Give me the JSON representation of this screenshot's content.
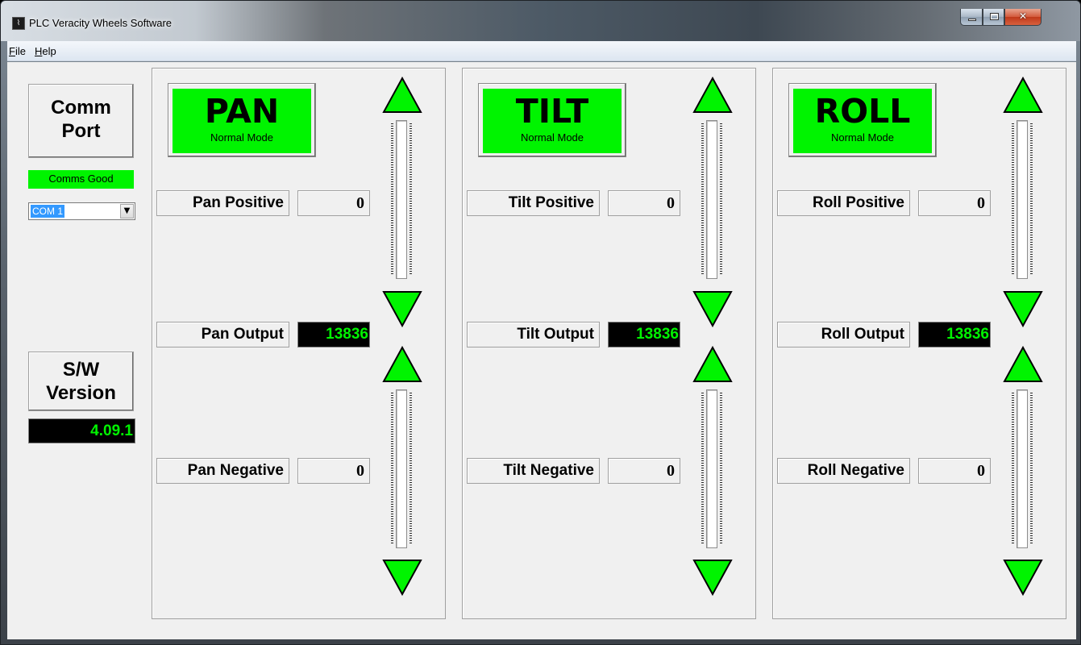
{
  "window": {
    "title": "PLC Veracity Wheels Software",
    "app_icon": "waveform-icon",
    "controls": {
      "minimize": "minimize-icon",
      "maximize": "maximize-icon",
      "close": "close-icon"
    }
  },
  "menu": [
    {
      "accel": "F",
      "rest": "ile"
    },
    {
      "accel": "H",
      "rest": "elp"
    }
  ],
  "left": {
    "comm_port_line1": "Comm",
    "comm_port_line2": "Port",
    "comms_status": "Comms Good",
    "com_select": {
      "value": "COM 1",
      "arrow": "▼"
    },
    "sw_line1": "S/W",
    "sw_line2": "Version",
    "sw_value": "4.09.1"
  },
  "panels": [
    {
      "title": "PAN",
      "mode": "Normal Mode",
      "positive_label": "Pan Positive",
      "positive_value": "0",
      "output_label": "Pan Output",
      "output_value": "13836",
      "negative_label": "Pan Negative",
      "negative_value": "0"
    },
    {
      "title": "TILT",
      "mode": "Normal Mode",
      "positive_label": "Tilt Positive",
      "positive_value": "0",
      "output_label": "Tilt Output",
      "output_value": "13836",
      "negative_label": "Tilt Negative",
      "negative_value": "0"
    },
    {
      "title": "ROLL",
      "mode": "Normal Mode",
      "positive_label": "Roll Positive",
      "positive_value": "0",
      "output_label": "Roll Output",
      "output_value": "13836",
      "negative_label": "Roll Negative",
      "negative_value": "0"
    }
  ],
  "colors": {
    "status_green": "#00f400",
    "display_black": "#000000",
    "panel_gray": "#f0f0f0"
  }
}
